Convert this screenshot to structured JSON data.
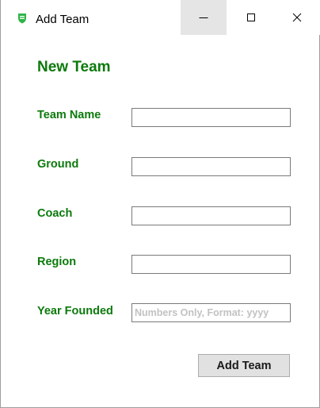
{
  "window": {
    "title": "Add Team",
    "icon": "green-shield-icon",
    "accent_color": "#0c7a0c"
  },
  "form": {
    "heading": "New Team",
    "fields": [
      {
        "label": "Team Name",
        "value": "",
        "placeholder": ""
      },
      {
        "label": "Ground",
        "value": "",
        "placeholder": ""
      },
      {
        "label": "Coach",
        "value": "",
        "placeholder": ""
      },
      {
        "label": "Region",
        "value": "",
        "placeholder": ""
      },
      {
        "label": "Year Founded",
        "value": "",
        "placeholder": "Numbers Only, Format: yyyy"
      }
    ],
    "submit_label": "Add Team"
  }
}
